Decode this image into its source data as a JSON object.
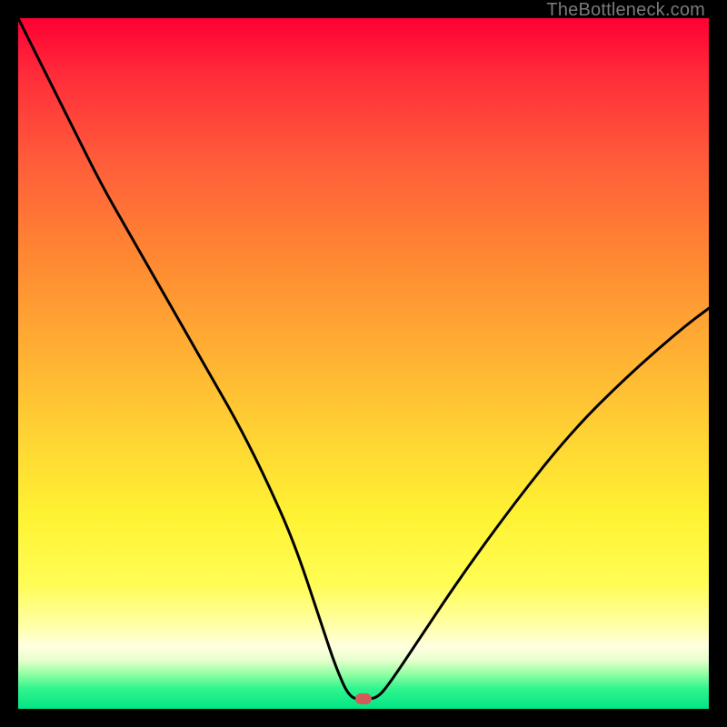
{
  "watermark": "TheBottleneck.com",
  "chart_data": {
    "type": "line",
    "title": "",
    "xlabel": "",
    "ylabel": "",
    "xlim": [
      0,
      100
    ],
    "ylim": [
      0,
      100
    ],
    "series": [
      {
        "name": "curve",
        "x": [
          0,
          4,
          8,
          12,
          16,
          20,
          24,
          28,
          32,
          36,
          40,
          44,
          46,
          48,
          50,
          52,
          54,
          58,
          64,
          72,
          80,
          88,
          96,
          100
        ],
        "y": [
          100,
          92,
          84,
          76,
          69,
          62,
          55,
          48,
          41,
          33,
          24,
          12,
          6,
          1.5,
          1.5,
          1.5,
          4,
          10,
          19,
          30,
          40,
          48,
          55,
          58
        ]
      }
    ],
    "marker": {
      "x": 50,
      "y": 1.5,
      "color": "#d45a5a"
    }
  }
}
